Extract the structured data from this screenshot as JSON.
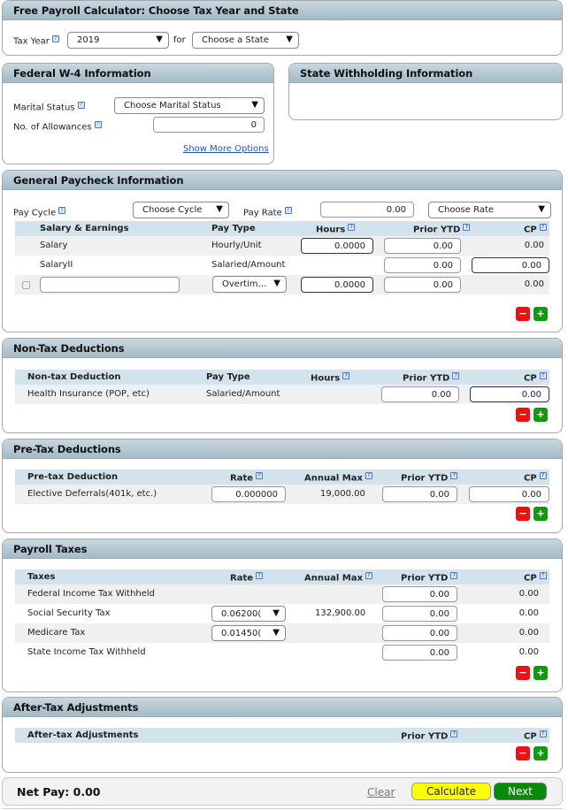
{
  "header_panel": {
    "title": "Free Payroll Calculator: Choose Tax Year and State",
    "tax_year_label": "Tax Year",
    "tax_year_value": "2019",
    "for_label": "for",
    "state_value": "Choose a State"
  },
  "federal_w4": {
    "title": "Federal W-4 Information",
    "marital_status_label": "Marital Status",
    "marital_status_value": "Choose Marital Status",
    "allowances_label": "No. of Allowances",
    "allowances_value": "0",
    "show_more_label": "Show More Options"
  },
  "state_withholding": {
    "title": "State Withholding Information"
  },
  "general_paycheck": {
    "title": "General Paycheck Information",
    "pay_cycle_label": "Pay Cycle",
    "pay_cycle_value": "Choose Cycle",
    "pay_rate_label": "Pay Rate",
    "pay_rate_value": "0.00",
    "rate_type_value": "Choose Rate",
    "columns": [
      "Salary & Earnings",
      "Pay Type",
      "Hours",
      "Prior YTD",
      "CP"
    ],
    "rows": [
      {
        "name": "Salary",
        "pay_type": "Hourly/Unit",
        "hours": "0.0000",
        "prior_ytd": "0.00",
        "cp": "0.00"
      },
      {
        "name": "SalaryII",
        "pay_type": "Salaried/Amount",
        "hours": "",
        "prior_ytd": "0.00",
        "cp": "0.00"
      },
      {
        "name": "",
        "pay_type": "Overtim…",
        "hours": "0.0000",
        "prior_ytd": "0.00",
        "cp": "0.00"
      }
    ]
  },
  "non_tax": {
    "title": "Non-Tax Deductions",
    "columns": [
      "Non-tax Deduction",
      "Pay Type",
      "Hours",
      "Prior YTD",
      "CP"
    ],
    "rows": [
      {
        "name": "Health Insurance (POP, etc)",
        "pay_type": "Salaried/Amount",
        "prior_ytd": "0.00",
        "cp": "0.00"
      }
    ]
  },
  "pre_tax": {
    "title": "Pre-Tax Deductions",
    "columns": [
      "Pre-tax Deduction",
      "Rate",
      "Annual Max",
      "Prior YTD",
      "CP"
    ],
    "rows": [
      {
        "name": "Elective Deferrals(401k, etc.)",
        "rate": "0.000000",
        "annual_max": "19,000.00",
        "prior_ytd": "0.00",
        "cp": "0.00"
      }
    ]
  },
  "payroll_taxes": {
    "title": "Payroll Taxes",
    "columns": [
      "Taxes",
      "Rate",
      "Annual Max",
      "Prior YTD",
      "CP"
    ],
    "rows": [
      {
        "name": "Federal Income Tax Withheld",
        "rate": "",
        "annual_max": "",
        "prior_ytd": "0.00",
        "cp": "0.00"
      },
      {
        "name": "Social Security Tax",
        "rate": "0.06200(",
        "annual_max": "132,900.00",
        "prior_ytd": "0.00",
        "cp": "0.00"
      },
      {
        "name": "Medicare Tax",
        "rate": "0.01450(",
        "annual_max": "",
        "prior_ytd": "0.00",
        "cp": "0.00"
      },
      {
        "name": "State Income Tax Withheld",
        "rate": "",
        "annual_max": "",
        "prior_ytd": "0.00",
        "cp": "0.00"
      }
    ]
  },
  "after_tax": {
    "title": "After-Tax Adjustments",
    "columns": [
      "After-tax Adjustments",
      "Prior YTD",
      "CP"
    ]
  },
  "footer": {
    "net_pay_label": "Net Pay: 0.00",
    "clear_label": "Clear",
    "calculate_label": "Calculate",
    "next_label": "Next"
  },
  "icons": {
    "help": "?",
    "dropdown": "▼",
    "minus": "−",
    "plus": "+"
  },
  "colors": {
    "panel_header": "#b5c8d3",
    "table_header": "#d3e3ee",
    "minus_button": "#ee1111",
    "plus_button": "#119911",
    "calculate_button": "#ffff00",
    "next_button": "#0a8a0a",
    "link": "#2255aa"
  }
}
